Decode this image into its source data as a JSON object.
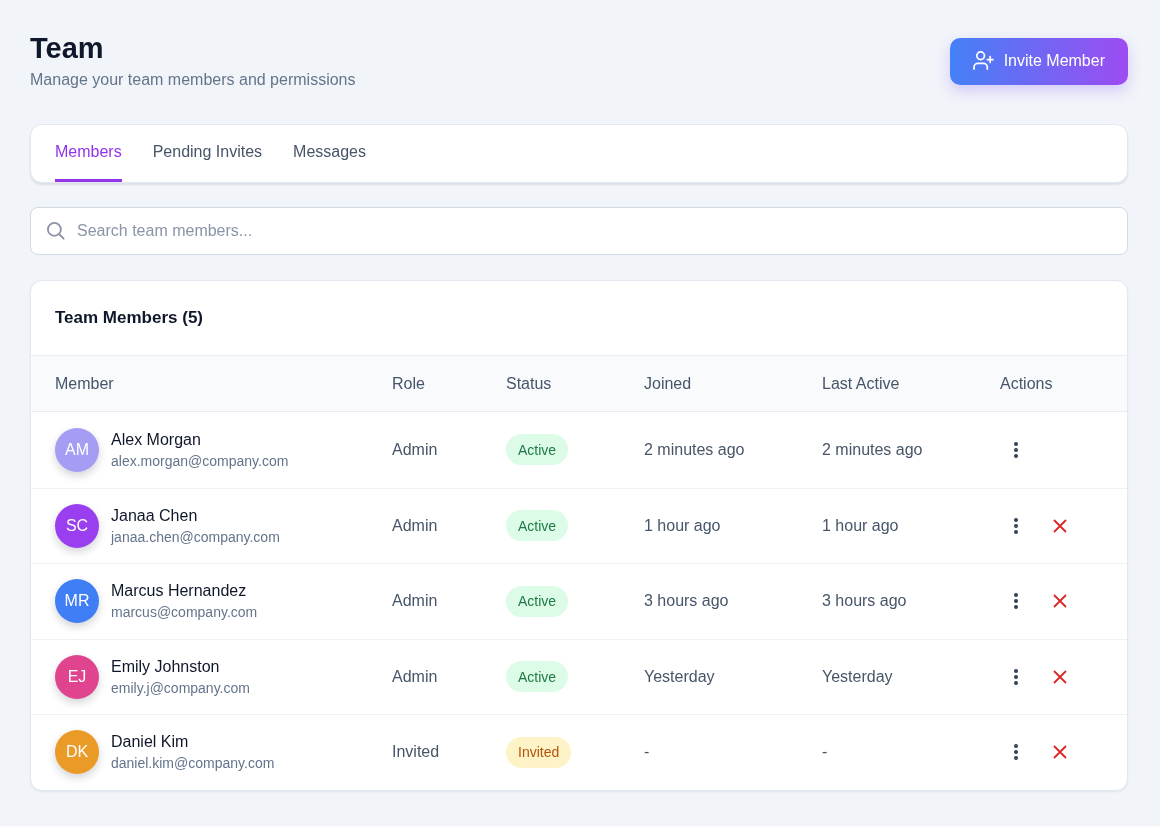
{
  "header": {
    "title": "Team",
    "subtitle": "Manage your team members and permissions",
    "invite_button": "Invite Member"
  },
  "tabs": [
    {
      "label": "Members",
      "selected": true
    },
    {
      "label": "Pending Invites",
      "selected": false
    },
    {
      "label": "Messages",
      "selected": false
    }
  ],
  "search": {
    "placeholder": "Search team members..."
  },
  "members_table": {
    "title": "Team Members (5)",
    "columns": [
      "Member",
      "Role",
      "Status",
      "Joined",
      "Last Active",
      "Actions"
    ],
    "rows": [
      {
        "initials": "AM",
        "color": "#a59cf4",
        "name": "Alex Morgan",
        "email": "alex.morgan@company.com",
        "role": "Admin",
        "status": {
          "label": "Active",
          "kind": "active"
        },
        "joined": "2 minutes ago",
        "last_active": "2 minutes ago",
        "removable": false
      },
      {
        "initials": "SC",
        "color": "#9a3ff0",
        "name": "Janaa Chen",
        "email": "janaa.chen@company.com",
        "role": "Admin",
        "status": {
          "label": "Active",
          "kind": "active"
        },
        "joined": "1 hour ago",
        "last_active": "1 hour ago",
        "removable": true
      },
      {
        "initials": "MR",
        "color": "#3f7ef5",
        "name": "Marcus Hernandez",
        "email": "marcus@company.com",
        "role": "Admin",
        "status": {
          "label": "Active",
          "kind": "active"
        },
        "joined": "3 hours ago",
        "last_active": "3 hours ago",
        "removable": true
      },
      {
        "initials": "EJ",
        "color": "#e0448e",
        "name": "Emily Johnston",
        "email": "emily.j@company.com",
        "role": "Admin",
        "status": {
          "label": "Active",
          "kind": "active"
        },
        "joined": "Yesterday",
        "last_active": "Yesterday",
        "removable": true
      },
      {
        "initials": "DK",
        "color": "#ea9a27",
        "name": "Daniel Kim",
        "email": "daniel.kim@company.com",
        "role": "Invited",
        "status": {
          "label": "Invited",
          "kind": "invited"
        },
        "joined": "-",
        "last_active": "-",
        "removable": true
      }
    ]
  }
}
